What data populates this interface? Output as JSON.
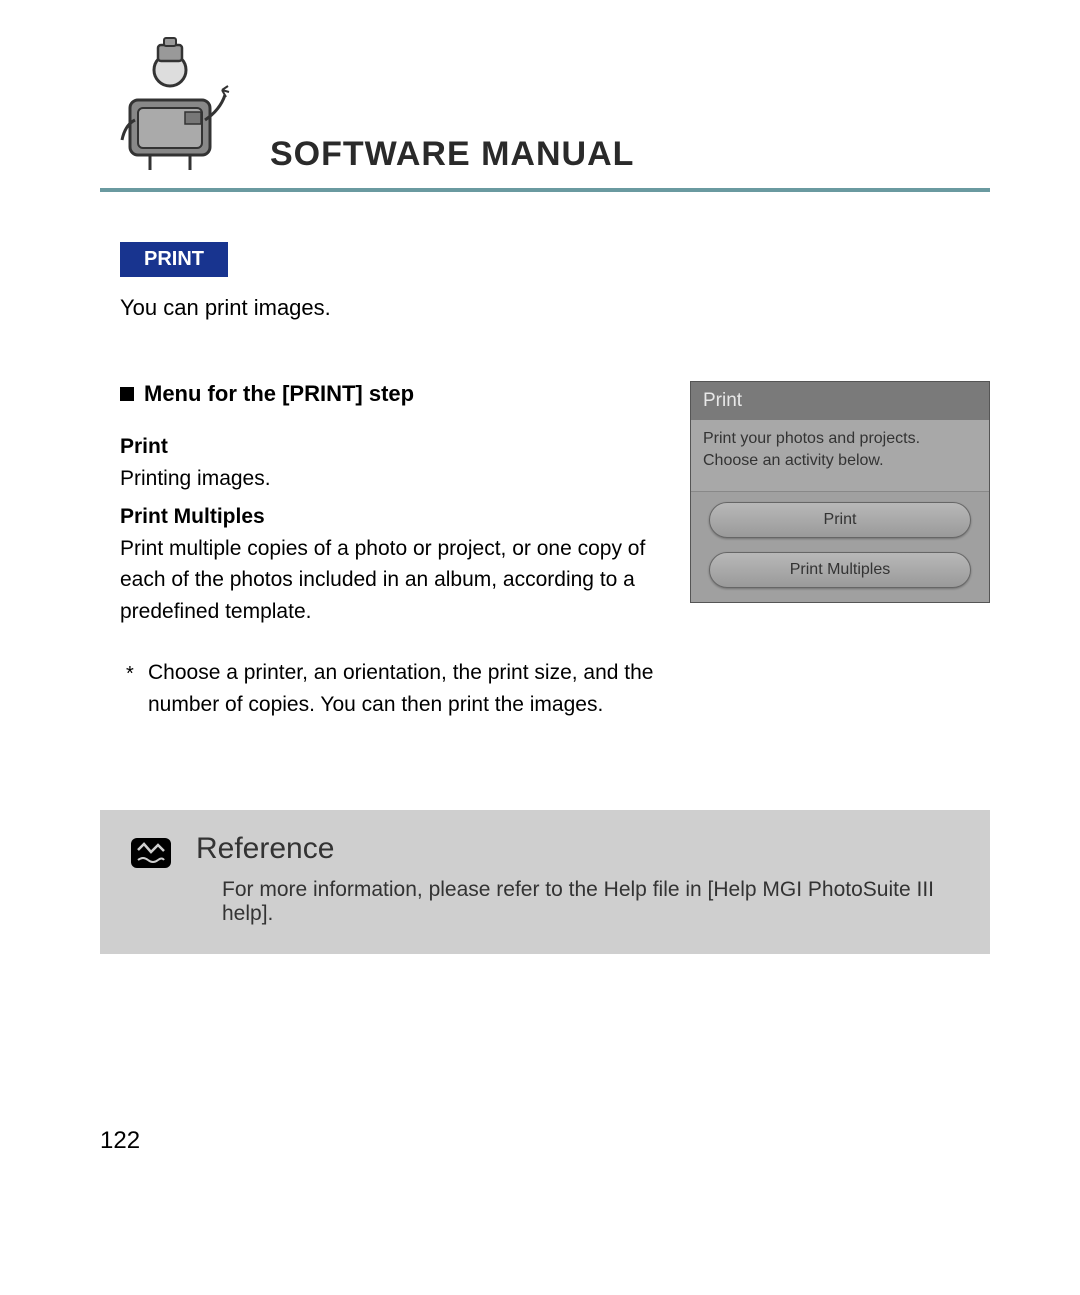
{
  "header": {
    "title": "SOFTWARE MANUAL"
  },
  "section": {
    "tag": "PRINT",
    "intro": "You can print images."
  },
  "menu": {
    "heading": "Menu for the [PRINT] step",
    "items": [
      {
        "title": "Print",
        "desc": "Printing images."
      },
      {
        "title": "Print Multiples",
        "desc": "Print multiple copies of a photo or project, or one copy of each of the photos included in an album, according to a predefined template."
      }
    ],
    "note": "Choose a printer, an orientation, the print size, and the number of copies. You can then print the images."
  },
  "screenshot": {
    "title": "Print",
    "subtitle": "Print your photos and projects. Choose an activity below.",
    "buttons": [
      "Print",
      "Print Multiples"
    ]
  },
  "reference": {
    "title": "Reference",
    "text": "For more information, please refer to the Help file in [Help MGI PhotoSuite III help]."
  },
  "page_number": "122"
}
